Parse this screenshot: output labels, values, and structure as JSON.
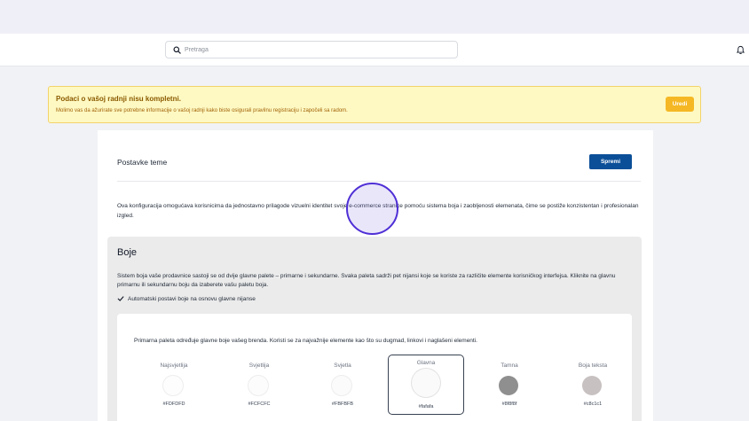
{
  "search": {
    "placeholder": "Pretraga",
    "value": ""
  },
  "alert": {
    "title": "Podaci o vašoj radnji nisu kompletni.",
    "text": "Molimo vas da ažurirate sve potrebne informacije o vašoj radnji kako biste osigurali pravilnu registraciju i započeli sa radom.",
    "button": "Uredi"
  },
  "card": {
    "title": "Postavke teme",
    "save_label": "Spremi",
    "intro": "Ova konfiguracija omogućava korisnicima da jednostavno prilagode vizuelni identitet svoje e-commerce stranice pomoću sistema boja i zaobljenosti elemenata, čime se postiže konzistentan i profesionalan izgled."
  },
  "colors_section": {
    "title": "Boje",
    "description": "Sistem boja vaše prodavnice sastoji se od dvije glavne palete – primarne i sekundarne. Svaka paleta sadrži pet nijansi koje se koriste za različite elemente korisničkog interfejsa. Kliknite na glavnu primarnu ili sekundarnu boju da izaberete vašu paletu boja.",
    "auto_label": "Automatski postavi boje na osnovu glavne nijanse",
    "primary_description": "Primarna paleta određuje glavne boje vašeg brenda. Koristi se za najvažnije elemente kao što su dugmad, linkovi i naglašeni elementi.",
    "swatches": [
      {
        "label": "Najsvjetlija",
        "hex": "#FDFDFD",
        "color": "#fdfdfd",
        "selected": false
      },
      {
        "label": "Svjetlija",
        "hex": "#FCFCFC",
        "color": "#fcfcfc",
        "selected": false
      },
      {
        "label": "Svjetla",
        "hex": "#FBFBFB",
        "color": "#fbfbfb",
        "selected": false
      },
      {
        "label": "Glavna",
        "hex": "#fafafa",
        "color": "#fafafa",
        "selected": true
      },
      {
        "label": "Tamna",
        "hex": "#8f8f8f",
        "color": "#8f8f8f",
        "selected": false
      },
      {
        "label": "Boja teksta",
        "hex": "#c8c1c1",
        "color": "#c8c1c1",
        "selected": false
      }
    ]
  },
  "colors": {
    "primary_button": "#0b4f98",
    "alert_background": "#fef9c3",
    "alert_button": "#f5b824",
    "cursor": "#4f2fd6"
  }
}
